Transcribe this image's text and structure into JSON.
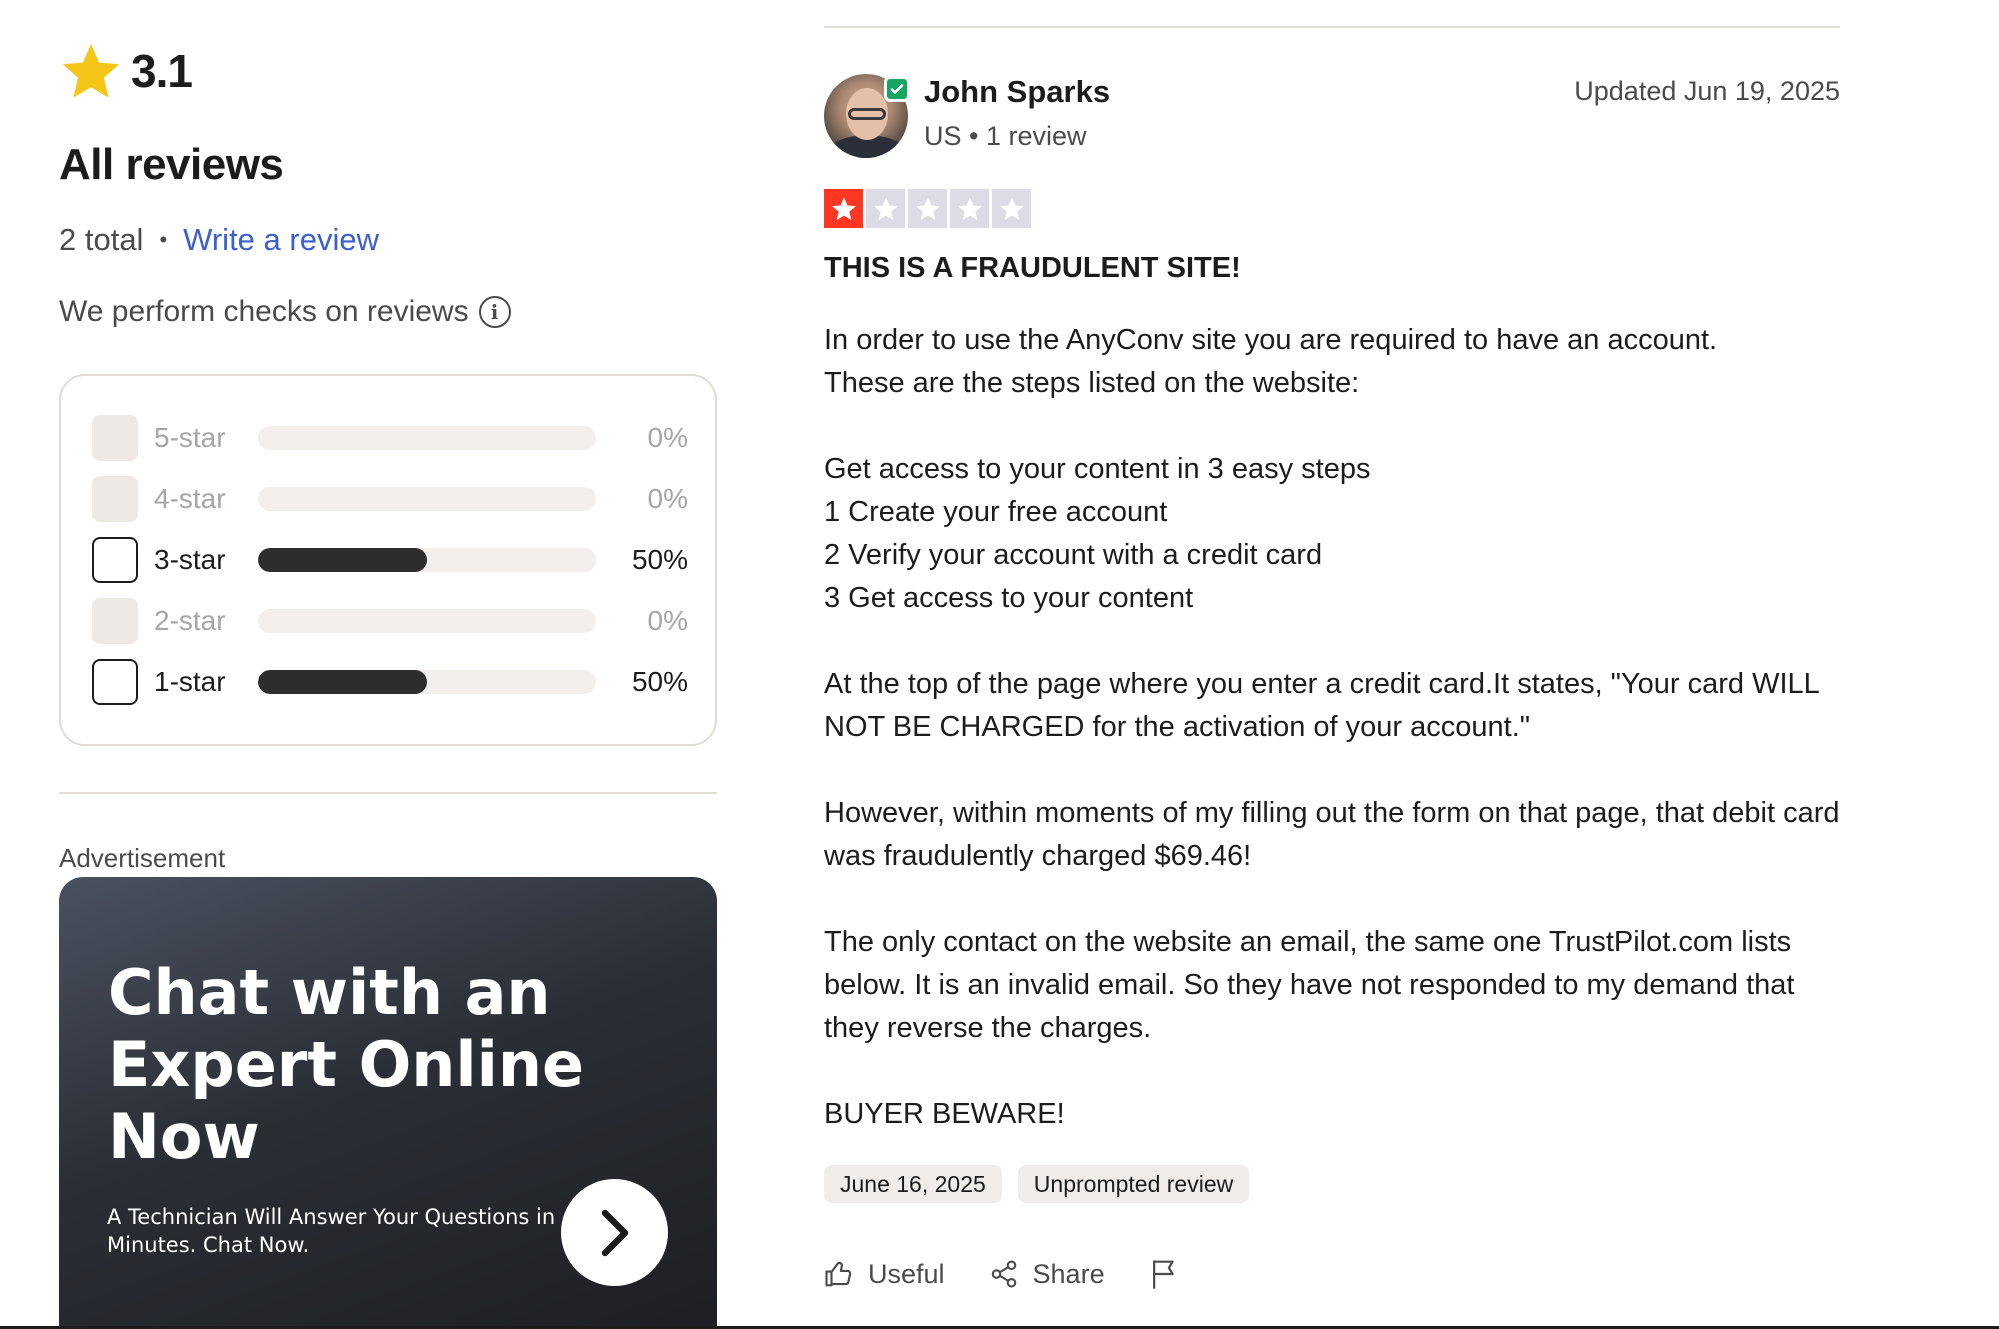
{
  "summary": {
    "rating": "3.1",
    "heading": "All reviews",
    "total": "2 total",
    "separator": "•",
    "write_review": "Write a review",
    "checks_text": "We perform checks on reviews",
    "info_glyph": "i"
  },
  "distribution": [
    {
      "label": "5-star",
      "percent_text": "0%",
      "fraction": 0.0,
      "enabled": false
    },
    {
      "label": "4-star",
      "percent_text": "0%",
      "fraction": 0.0,
      "enabled": false
    },
    {
      "label": "3-star",
      "percent_text": "50%",
      "fraction": 0.5,
      "enabled": true
    },
    {
      "label": "2-star",
      "percent_text": "0%",
      "fraction": 0.0,
      "enabled": false
    },
    {
      "label": "1-star",
      "percent_text": "50%",
      "fraction": 0.5,
      "enabled": true
    }
  ],
  "ad": {
    "label": "Advertisement",
    "title": "Chat with an Expert Online Now",
    "subtitle": "A Technician Will Answer Your Questions in Minutes. Chat Now."
  },
  "review": {
    "author": "John Sparks",
    "meta": "US • 1 review",
    "updated": "Updated Jun 19, 2025",
    "stars": 1,
    "title": "THIS IS A FRAUDULENT SITE!",
    "paragraphs": [
      "In order to use the AnyConv site you are required to have an account.\nThese are the steps listed on the website:",
      "Get access to your content in 3 easy steps\n1 Create your free account\n2 Verify your account with a credit card\n3 Get access to your content",
      "At the top of the page where you enter a credit card.It states, \"Your card WILL NOT BE CHARGED for the activation of your account.\"",
      "However, within moments of my filling out the form on that page, that debit card was fraudulently charged $69.46!",
      "The only contact on the website an email, the same one TrustPilot.com lists below. It is an invalid email. So they have not responded to my demand that they reverse the charges.",
      "BUYER BEWARE!"
    ],
    "date_chip": "June 16, 2025",
    "type_chip": "Unprompted review",
    "useful_label": "Useful",
    "share_label": "Share"
  },
  "colors": {
    "accent_link": "#3b5ed1",
    "star_gold": "#f5c518",
    "trust_red": "#ff3722",
    "verified_green": "#17a562"
  },
  "icons": {
    "summary_star": "star-icon",
    "info": "info-icon",
    "verified": "verified-check-icon",
    "ad_arrow": "chevron-right-icon",
    "useful": "thumbs-up-icon",
    "share": "share-icon",
    "report": "flag-icon"
  }
}
